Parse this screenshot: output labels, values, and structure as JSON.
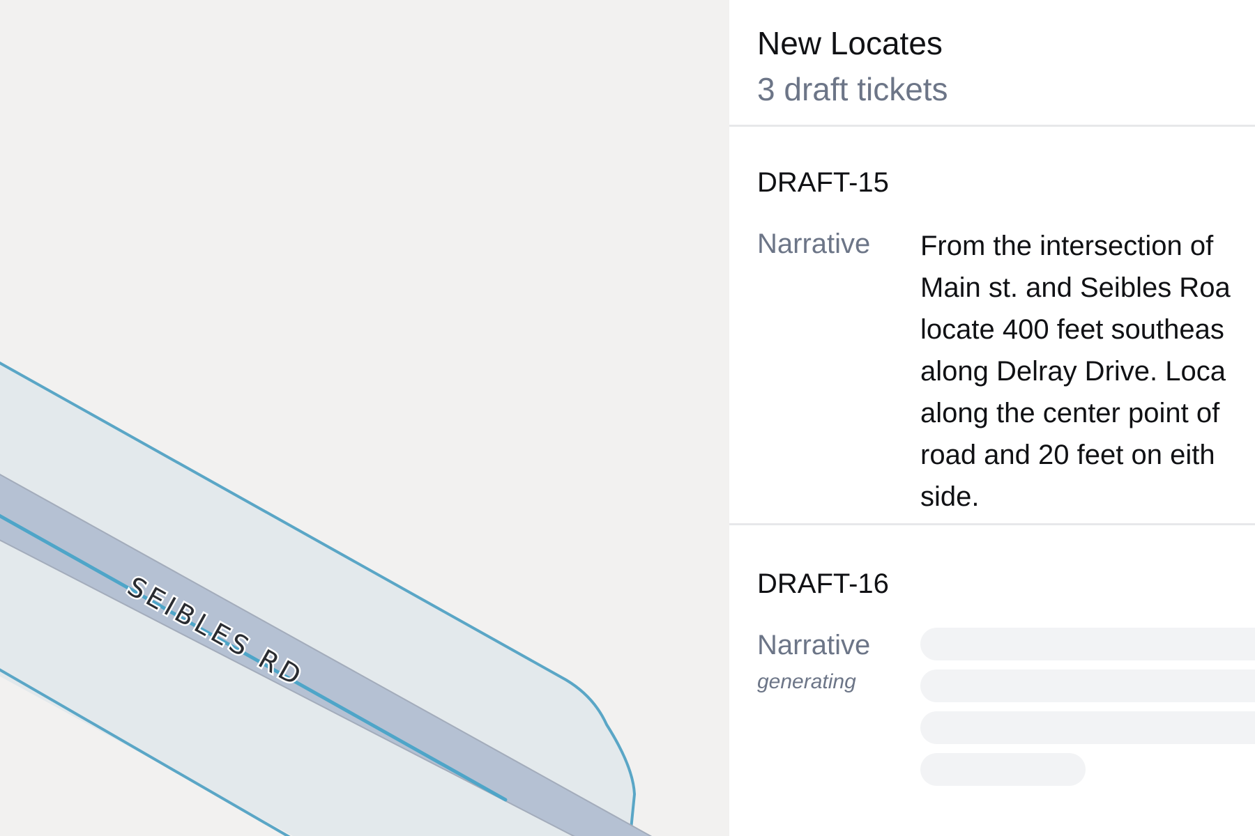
{
  "map": {
    "road_label": "SEIBLES RD",
    "colors": {
      "background": "#f2f1f0",
      "buffer_fill": "#e3e9ec",
      "buffer_stroke": "#5aa6c6",
      "road_fill": "#b5c1d3",
      "road_edge": "#a3acbb",
      "centerline": "#4ea5c8"
    }
  },
  "panel": {
    "title": "New Locates",
    "subtitle": "3 draft tickets",
    "tickets": [
      {
        "id": "DRAFT-15",
        "field_label": "Narrative",
        "narrative_lines": [
          "From the intersection of",
          "Main st. and Seibles Roa",
          "locate 400 feet southeas",
          "along Delray Drive. Loca",
          "along the center point of",
          "road and 20 feet on eith",
          "side."
        ]
      },
      {
        "id": "DRAFT-16",
        "field_label": "Narrative",
        "status": "generating"
      }
    ]
  }
}
